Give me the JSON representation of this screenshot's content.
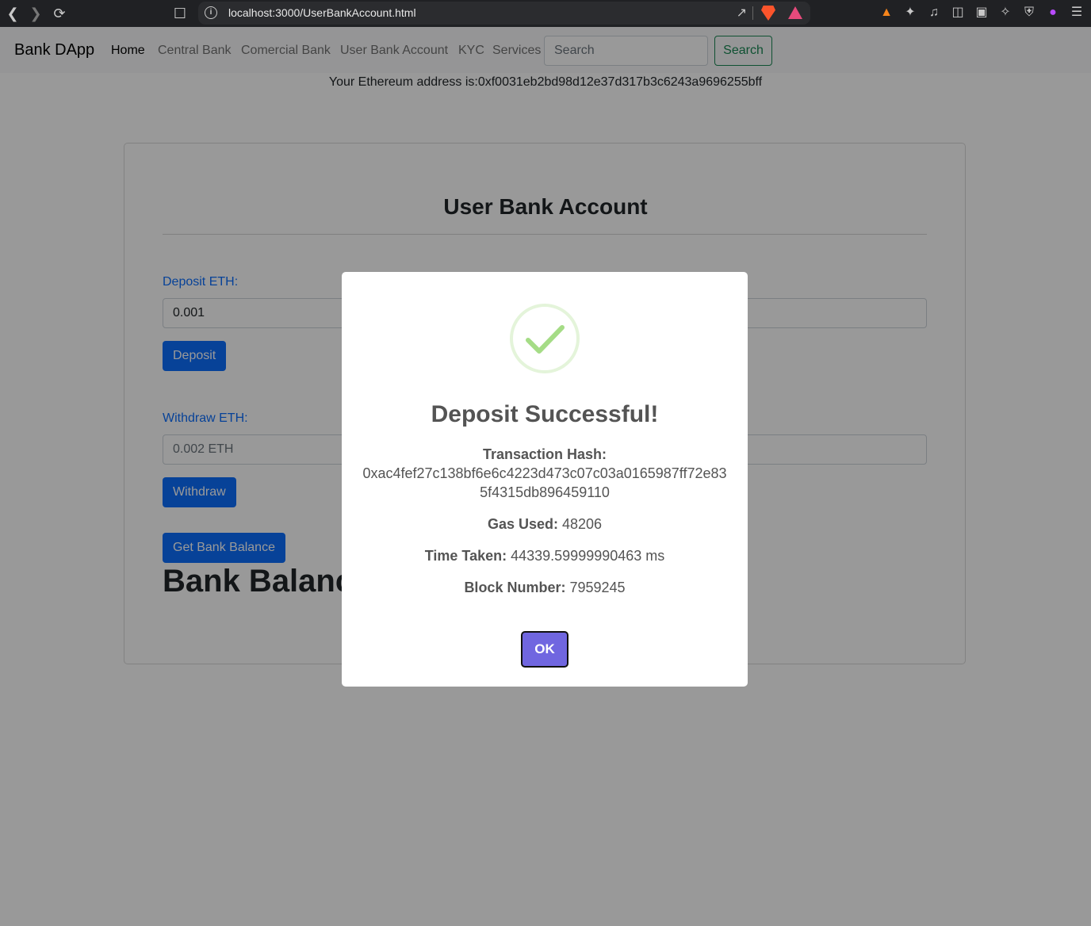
{
  "browser": {
    "url": "localhost:3000/UserBankAccount.html"
  },
  "navbar": {
    "brand": "Bank DApp",
    "links": [
      "Home",
      "Central Bank",
      "Comercial Bank",
      "User Bank Account",
      "KYC",
      "Services"
    ],
    "search_placeholder": "Search",
    "search_button": "Search"
  },
  "eth_address": "Your Ethereum address is:0xf0031eb2bd98d12e37d317b3c6243a9696255bff",
  "card": {
    "title": "User Bank Account",
    "deposit_label": "Deposit ETH:",
    "deposit_value": "0.001",
    "deposit_button": "Deposit",
    "withdraw_label": "Withdraw ETH:",
    "withdraw_placeholder": "0.002 ETH",
    "withdraw_button": "Withdraw",
    "balance_button": "Get Bank Balance",
    "balance_heading": "Bank Balance"
  },
  "modal": {
    "title": "Deposit Successful!",
    "hash_label": "Transaction Hash:",
    "hash_value": "0xac4fef27c138bf6e6c4223d473c07c03a0165987ff72e835f4315db896459110",
    "gas_label": "Gas Used:",
    "gas_value": "48206",
    "time_label": "Time Taken:",
    "time_value": "44339.59999990463 ms",
    "block_label": "Block Number:",
    "block_value": "7959245",
    "ok_button": "OK"
  },
  "colors": {
    "primary": "#0d6efd",
    "success": "#198754",
    "confirm": "#7066e0",
    "check": "#a5dc86"
  }
}
